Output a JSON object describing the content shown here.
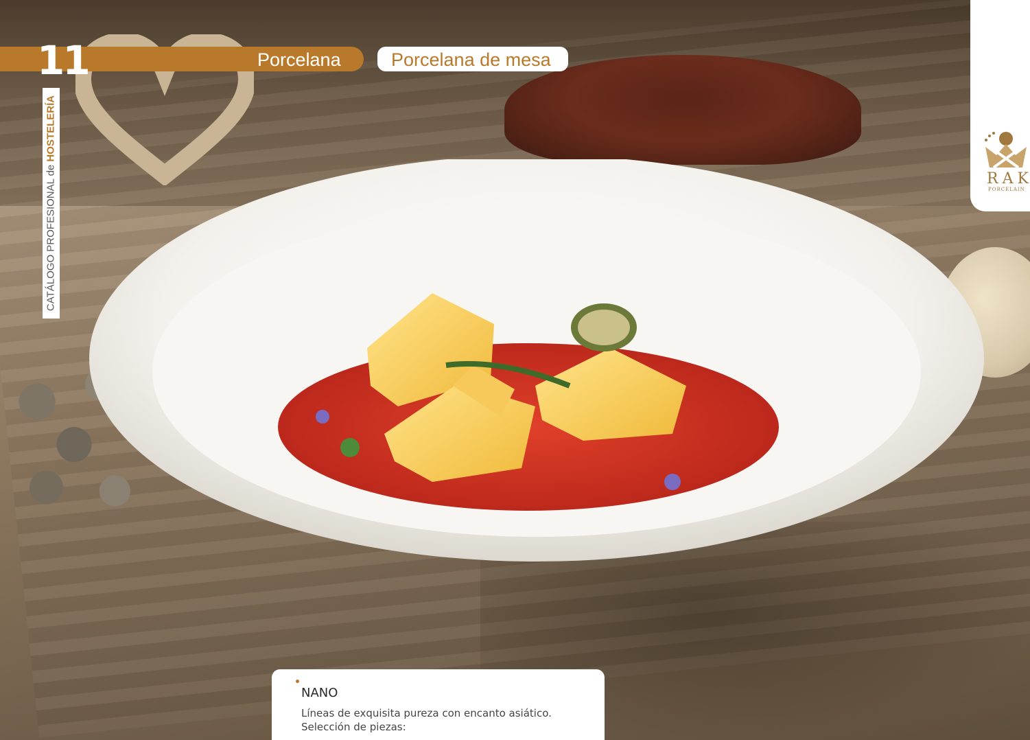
{
  "header": {
    "page_number": "11",
    "section": "Porcelana",
    "subsection": "Porcelana de mesa"
  },
  "side_label": {
    "prefix": "CATÁLOGO PROFESIONAL de ",
    "emphasis": "HOSTELERÍA"
  },
  "brand": {
    "name": "RAK",
    "sub": "PORCELAIN",
    "logo_icon": "crown-icon",
    "accent_color": "#b87a2a"
  },
  "product": {
    "name": "NANO",
    "description_line1": "Líneas de exquisita pureza con encanto asiático.",
    "description_line2": "Selección de piezas:"
  }
}
